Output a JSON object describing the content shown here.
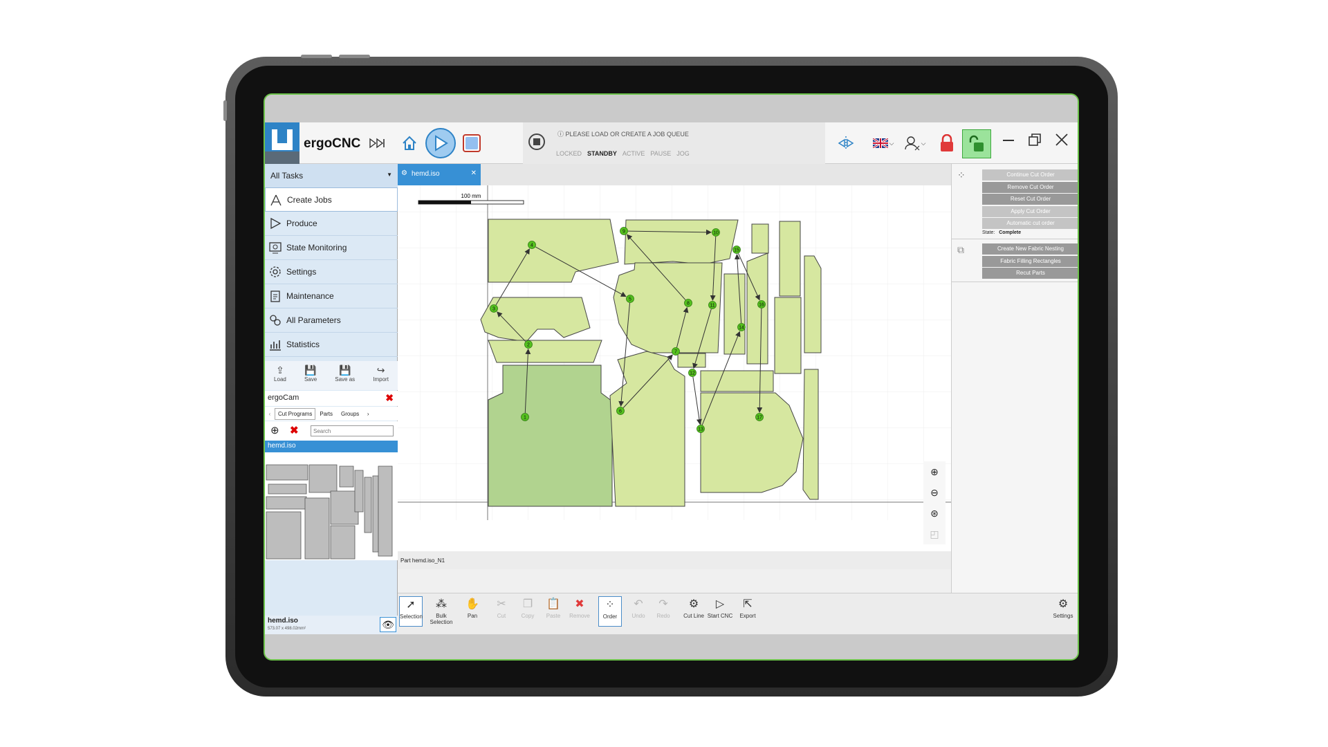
{
  "app": {
    "title": "ergoCNC"
  },
  "status": {
    "message": "PLEASE LOAD OR CREATE A JOB QUEUE",
    "states": [
      "LOCKED",
      "STANDBY",
      "ACTIVE",
      "PAUSE",
      "JOG"
    ],
    "active_state": "STANDBY"
  },
  "sidebar": {
    "dropdown": "All Tasks",
    "items": [
      {
        "label": "Create Jobs",
        "icon": "compass-icon"
      },
      {
        "label": "Produce",
        "icon": "play-icon"
      },
      {
        "label": "State Monitoring",
        "icon": "monitor-icon"
      },
      {
        "label": "Settings",
        "icon": "gear-icon"
      },
      {
        "label": "Maintenance",
        "icon": "clipboard-icon"
      },
      {
        "label": "All Parameters",
        "icon": "gears-icon"
      },
      {
        "label": "Statistics",
        "icon": "chart-icon"
      }
    ],
    "tools": [
      "Load",
      "Save",
      "Save as",
      "Import"
    ],
    "section": "ergoCam",
    "subtabs": [
      "Cut Programs",
      "Parts",
      "Groups"
    ],
    "search_placeholder": "Search",
    "selected_file": "hemd.iso",
    "footer_name": "hemd.iso",
    "footer_dims": "573.07 x 498.02mm²"
  },
  "canvas": {
    "tab_label": "hemd.iso",
    "scale_label": "100 mm",
    "status_text": "Part hemd.iso_N1",
    "order_labels": [
      "1",
      "2",
      "3",
      "4",
      "5",
      "6",
      "7",
      "8",
      "9",
      "10",
      "11",
      "12",
      "13",
      "14",
      "15",
      "16",
      "17"
    ]
  },
  "rightpanel": {
    "buttons1": [
      {
        "label": "Continue Cut Order",
        "enabled": false
      },
      {
        "label": "Remove Cut Order",
        "enabled": true
      },
      {
        "label": "Reset Cut Order",
        "enabled": true
      },
      {
        "label": "Apply Cut Order",
        "enabled": false
      },
      {
        "label": "Automatic cut order",
        "enabled": false
      }
    ],
    "state_label": "State:",
    "state_value": "Complete",
    "buttons2": [
      "Create New Fabric Nesting",
      "Fabric Filling Rectangles",
      "Recut Parts"
    ]
  },
  "toolbar": [
    {
      "label": "Selection",
      "enabled": true,
      "active": true
    },
    {
      "label": "Bulk Selection",
      "enabled": true
    },
    {
      "label": "Pan",
      "enabled": true
    },
    {
      "label": "Cut",
      "enabled": false
    },
    {
      "label": "Copy",
      "enabled": false
    },
    {
      "label": "Paste",
      "enabled": false
    },
    {
      "label": "Remove",
      "enabled": false
    },
    {
      "label": "Order",
      "enabled": true,
      "active": true
    },
    {
      "label": "Undo",
      "enabled": false
    },
    {
      "label": "Redo",
      "enabled": false
    },
    {
      "label": "Cut Line",
      "enabled": true
    },
    {
      "label": "Start CNC",
      "enabled": true
    },
    {
      "label": "Export",
      "enabled": true
    },
    {
      "label": "Settings",
      "enabled": true
    }
  ],
  "colors": {
    "accent": "#3790d5",
    "piece": "#d6e7a0",
    "piece_selected": "#b1d38f",
    "marker": "#55c11e",
    "tablet_border": "#6cc34a"
  }
}
